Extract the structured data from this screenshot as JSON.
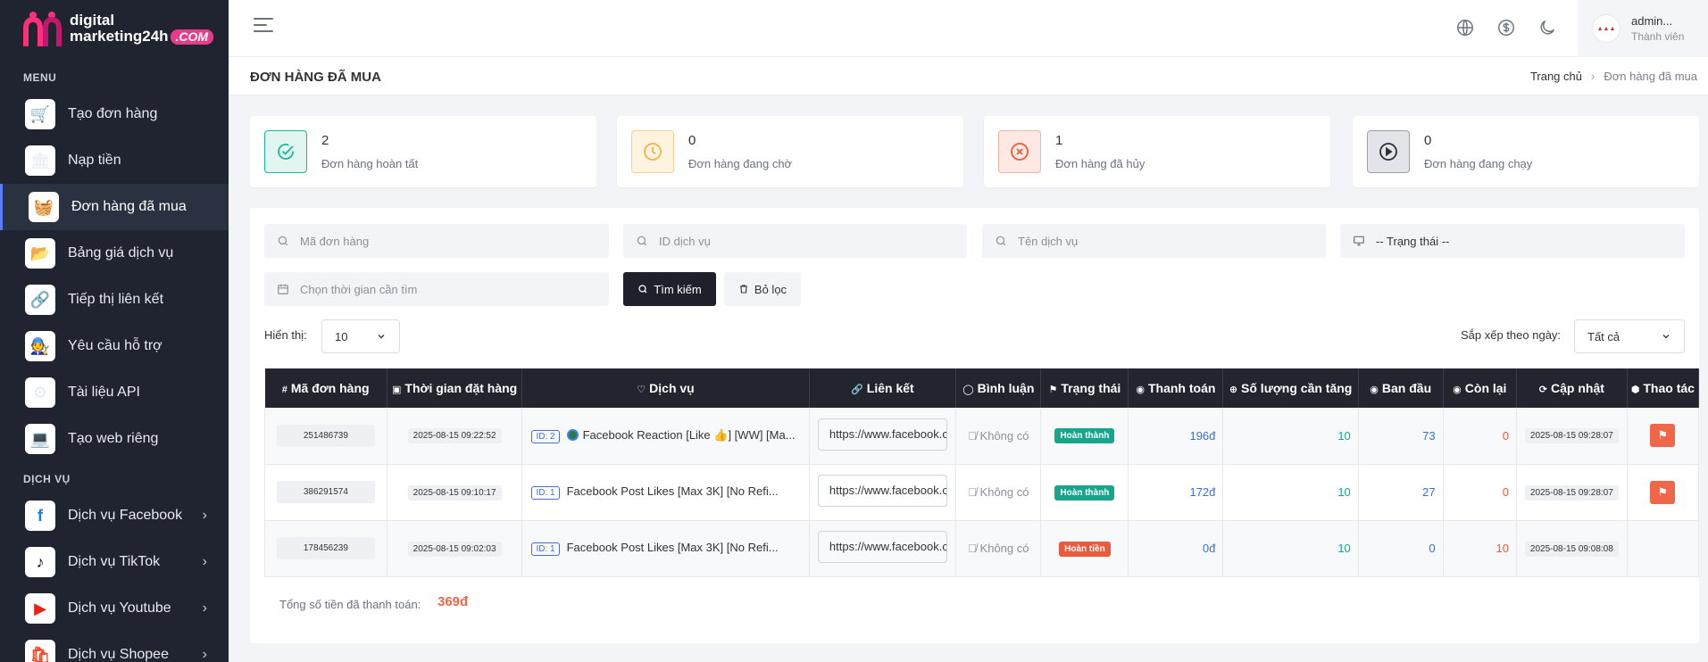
{
  "brand": {
    "line1": "digital",
    "line2": "marketing24h",
    "suffix": ".COM"
  },
  "sidebar": {
    "menu_title": "MENU",
    "items": [
      {
        "label": "Tạo đơn hàng",
        "icon": "🛒"
      },
      {
        "label": "Nạp tiền",
        "icon": "🏛"
      },
      {
        "label": "Đơn hàng đã mua",
        "icon": "🧺"
      },
      {
        "label": "Bảng giá dịch vụ",
        "icon": "📂"
      },
      {
        "label": "Tiếp thị liên kết",
        "icon": "🔗"
      },
      {
        "label": "Yêu cầu hỗ trợ",
        "icon": "🧑‍🔧"
      },
      {
        "label": "Tài liệu API",
        "icon": "⚙"
      },
      {
        "label": "Tạo web riêng",
        "icon": "💻"
      }
    ],
    "services_title": "DỊCH VỤ",
    "services": [
      {
        "label": "Dịch vụ Facebook",
        "icon": "f"
      },
      {
        "label": "Dịch vụ TikTok",
        "icon": "♪"
      },
      {
        "label": "Dịch vụ Youtube",
        "icon": "▶"
      },
      {
        "label": "Dịch vụ Shopee",
        "icon": "🛍"
      }
    ]
  },
  "user": {
    "name": "admin...",
    "role": "Thành viên"
  },
  "page": {
    "title": "ĐƠN HÀNG ĐÃ MUA",
    "breadcrumb_home": "Trang chủ",
    "breadcrumb_current": "Đơn hàng đã mua"
  },
  "stats": [
    {
      "value": "2",
      "label": "Đơn hàng hoàn tất",
      "color": "#1fb59a",
      "bg": "#e2f6f1"
    },
    {
      "value": "0",
      "label": "Đơn hàng đang chờ",
      "color": "#f2b544",
      "bg": "#fdf3df"
    },
    {
      "value": "1",
      "label": "Đơn hàng đã hủy",
      "color": "#ea5a3c",
      "bg": "#fde8e3"
    },
    {
      "value": "0",
      "label": "Đơn hàng đang chạy",
      "color": "#2b2f36",
      "bg": "#e2e4e9"
    }
  ],
  "filters": {
    "order_code": "Mã đơn hàng",
    "service_id": "ID dịch vụ",
    "service_name": "Tên dịch vụ",
    "status": "-- Trạng thái --",
    "time": "Chọn thời gian cần tìm",
    "search_btn": "Tìm kiếm",
    "filter_btn": "Bỏ lọc",
    "show_label": "Hiển thị:",
    "show_value": "10",
    "sort_label": "Sắp xếp theo ngày:",
    "sort_value": "Tất cả"
  },
  "table": {
    "headers": [
      "Mã đơn hàng",
      "Thời gian đặt hàng",
      "Dịch vụ",
      "Liên kết",
      "Bình luận",
      "Trạng thái",
      "Thanh toán",
      "Số lượng cần tăng",
      "Ban đầu",
      "Còn lại",
      "Cập nhật",
      "Thao tác"
    ],
    "rows": [
      {
        "code": "251486739",
        "time": "2025-08-15 09:22:52",
        "svc_id": "ID: 2",
        "service": "Facebook Reaction [Like 👍] [WW] [Ma...",
        "link": "https://www.facebook.com",
        "comment": "Không có",
        "status": "Hoàn thành",
        "status_color": "#19a58c",
        "pay": "196đ",
        "qty": "10",
        "start": "73",
        "remain": "0",
        "updated": "2025-08-15 09:28:07"
      },
      {
        "code": "386291574",
        "time": "2025-08-15 09:10:17",
        "svc_id": "ID: 1",
        "service": "Facebook Post Likes [Max 3K] [No Refi...",
        "link": "https://www.facebook.com",
        "comment": "Không có",
        "status": "Hoàn thành",
        "status_color": "#19a58c",
        "pay": "172đ",
        "qty": "10",
        "start": "27",
        "remain": "0",
        "updated": "2025-08-15 09:28:07"
      },
      {
        "code": "178456239",
        "time": "2025-08-15 09:02:03",
        "svc_id": "ID: 1",
        "service": "Facebook Post Likes [Max 3K] [No Refi...",
        "link": "https://www.facebook.com",
        "comment": "Không có",
        "status": "Hoàn tiền",
        "status_color": "#ea5a3c",
        "pay": "0đ",
        "qty": "10",
        "start": "0",
        "remain": "10",
        "updated": "2025-08-15 09:08:08"
      }
    ]
  },
  "total": {
    "label": "Tổng số tiền đã thanh toán:",
    "value": "369đ"
  }
}
